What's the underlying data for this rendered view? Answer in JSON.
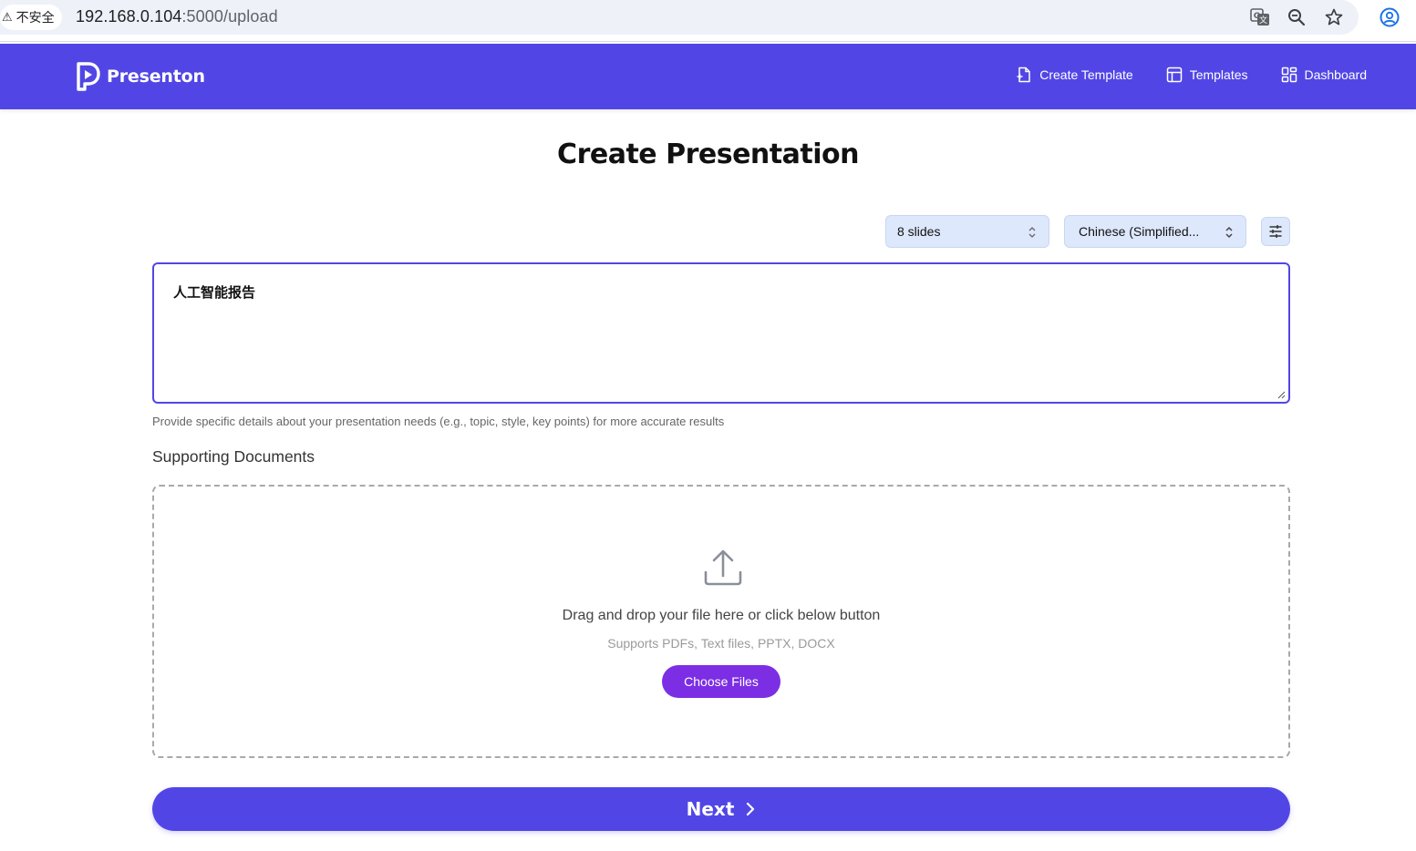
{
  "browser": {
    "security_label": "不安全",
    "url_host": "192.168.0.104",
    "url_path": ":5000/upload",
    "icons": [
      "warning-icon",
      "translate-icon",
      "zoom-icon",
      "bookmark-star-icon",
      "profile-icon"
    ]
  },
  "header": {
    "brand_name": "Presenton",
    "nav": {
      "create_template": "Create Template",
      "templates": "Templates",
      "dashboard": "Dashboard"
    },
    "color": "#5146e5"
  },
  "main": {
    "title": "Create Presentation",
    "slides_select": {
      "value": "8 slides"
    },
    "language_select": {
      "value": "Chinese (Simplified..."
    },
    "prompt": {
      "value": "人工智能报告"
    },
    "helper_text": "Provide specific details about your presentation needs (e.g., topic, style, key points) for more accurate results",
    "supporting_label": "Supporting Documents",
    "dropzone": {
      "main_text": "Drag and drop your file here or click below button",
      "sub_text": "Supports PDFs, Text files, PPTX, DOCX",
      "button_label": "Choose Files"
    },
    "next_label": "Next"
  },
  "colors": {
    "primary": "#5146e5",
    "choose_button": "#7c2ee4",
    "select_bg": "#dde8fc"
  }
}
